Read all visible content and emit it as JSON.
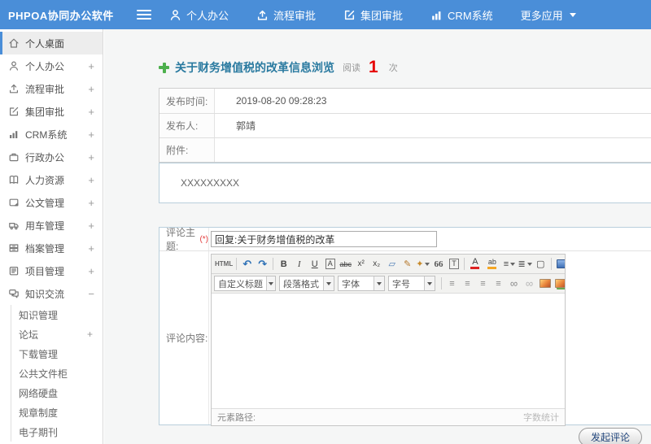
{
  "topbar": {
    "brand": "PHPOA协同办公软件",
    "menu": [
      {
        "label": "个人办公",
        "icon": "user-icon"
      },
      {
        "label": "流程审批",
        "icon": "upload-icon"
      },
      {
        "label": "集团审批",
        "icon": "edit-icon"
      },
      {
        "label": "CRM系统",
        "icon": "bar-chart-icon"
      },
      {
        "label": "更多应用",
        "icon": "caret-down-icon"
      }
    ]
  },
  "sidebar": {
    "items": [
      {
        "label": "个人桌面",
        "expand": "",
        "icon": "home-icon"
      },
      {
        "label": "个人办公",
        "expand": "+",
        "icon": "user-icon"
      },
      {
        "label": "流程审批",
        "expand": "+",
        "icon": "upload-icon"
      },
      {
        "label": "集团审批",
        "expand": "+",
        "icon": "edit-icon"
      },
      {
        "label": "CRM系统",
        "expand": "+",
        "icon": "bar-chart-icon"
      },
      {
        "label": "行政办公",
        "expand": "+",
        "icon": "briefcase-icon"
      },
      {
        "label": "人力资源",
        "expand": "+",
        "icon": "book-icon"
      },
      {
        "label": "公文管理",
        "expand": "+",
        "icon": "document-icon"
      },
      {
        "label": "用车管理",
        "expand": "+",
        "icon": "truck-icon"
      },
      {
        "label": "档案管理",
        "expand": "+",
        "icon": "archive-icon"
      },
      {
        "label": "项目管理",
        "expand": "+",
        "icon": "project-icon"
      },
      {
        "label": "知识交流",
        "expand": "−",
        "icon": "chat-icon"
      }
    ],
    "subitems": [
      {
        "label": "知识管理",
        "expand": ""
      },
      {
        "label": "论坛",
        "expand": "+"
      },
      {
        "label": "下载管理",
        "expand": ""
      },
      {
        "label": "公共文件柜",
        "expand": ""
      },
      {
        "label": "网络硬盘",
        "expand": ""
      },
      {
        "label": "规章制度",
        "expand": ""
      },
      {
        "label": "电子期刊",
        "expand": ""
      }
    ]
  },
  "content": {
    "title": "关于财务增值税的改革信息浏览",
    "read_label": "阅读",
    "read_count": "1",
    "read_unit": "次",
    "info_rows": [
      {
        "label": "发布时间:",
        "value": "2019-08-20 09:28:23"
      },
      {
        "label": "发布人:",
        "value": "郭靖"
      },
      {
        "label": "附件:",
        "value": ""
      }
    ],
    "body_text": "XXXXXXXXX",
    "form": {
      "subject_label": "评论主题:",
      "required_mark": "(*)",
      "subject_value": "回复:关于财务增值税的改革",
      "content_label": "评论内容:",
      "submit_label": "发起评论"
    },
    "editor": {
      "source_btn": "HTML",
      "heading_select": "自定义标题",
      "format_select": "段落格式",
      "font_select": "字体",
      "size_select": "字号",
      "path_label": "元素路径:",
      "count_label": "字数统计"
    }
  },
  "icons": {
    "undo": "↶",
    "redo": "↷",
    "bold": "B",
    "italic": "I",
    "underline": "U",
    "font_box": "A",
    "strikethrough": "abc",
    "superscript": "x²",
    "subscript": "x₂",
    "eraser": "▱",
    "brush": "✎",
    "autoformat": "✦",
    "blockquote": "66",
    "paste_text": "T",
    "text_color": "A",
    "highlight": "ab",
    "ordered_list": "≡",
    "bullet_list": "≣",
    "new_page": "▢",
    "align_left": "≡",
    "align_center": "≡",
    "align_right": "≡",
    "align_justify": "≡",
    "link": "∞",
    "unlink": "∞",
    "table": "▦"
  },
  "colors": {
    "topbar": "#4a8ed8",
    "title": "#2a7aa0",
    "count": "#e60000",
    "plus": "#4db04d"
  }
}
